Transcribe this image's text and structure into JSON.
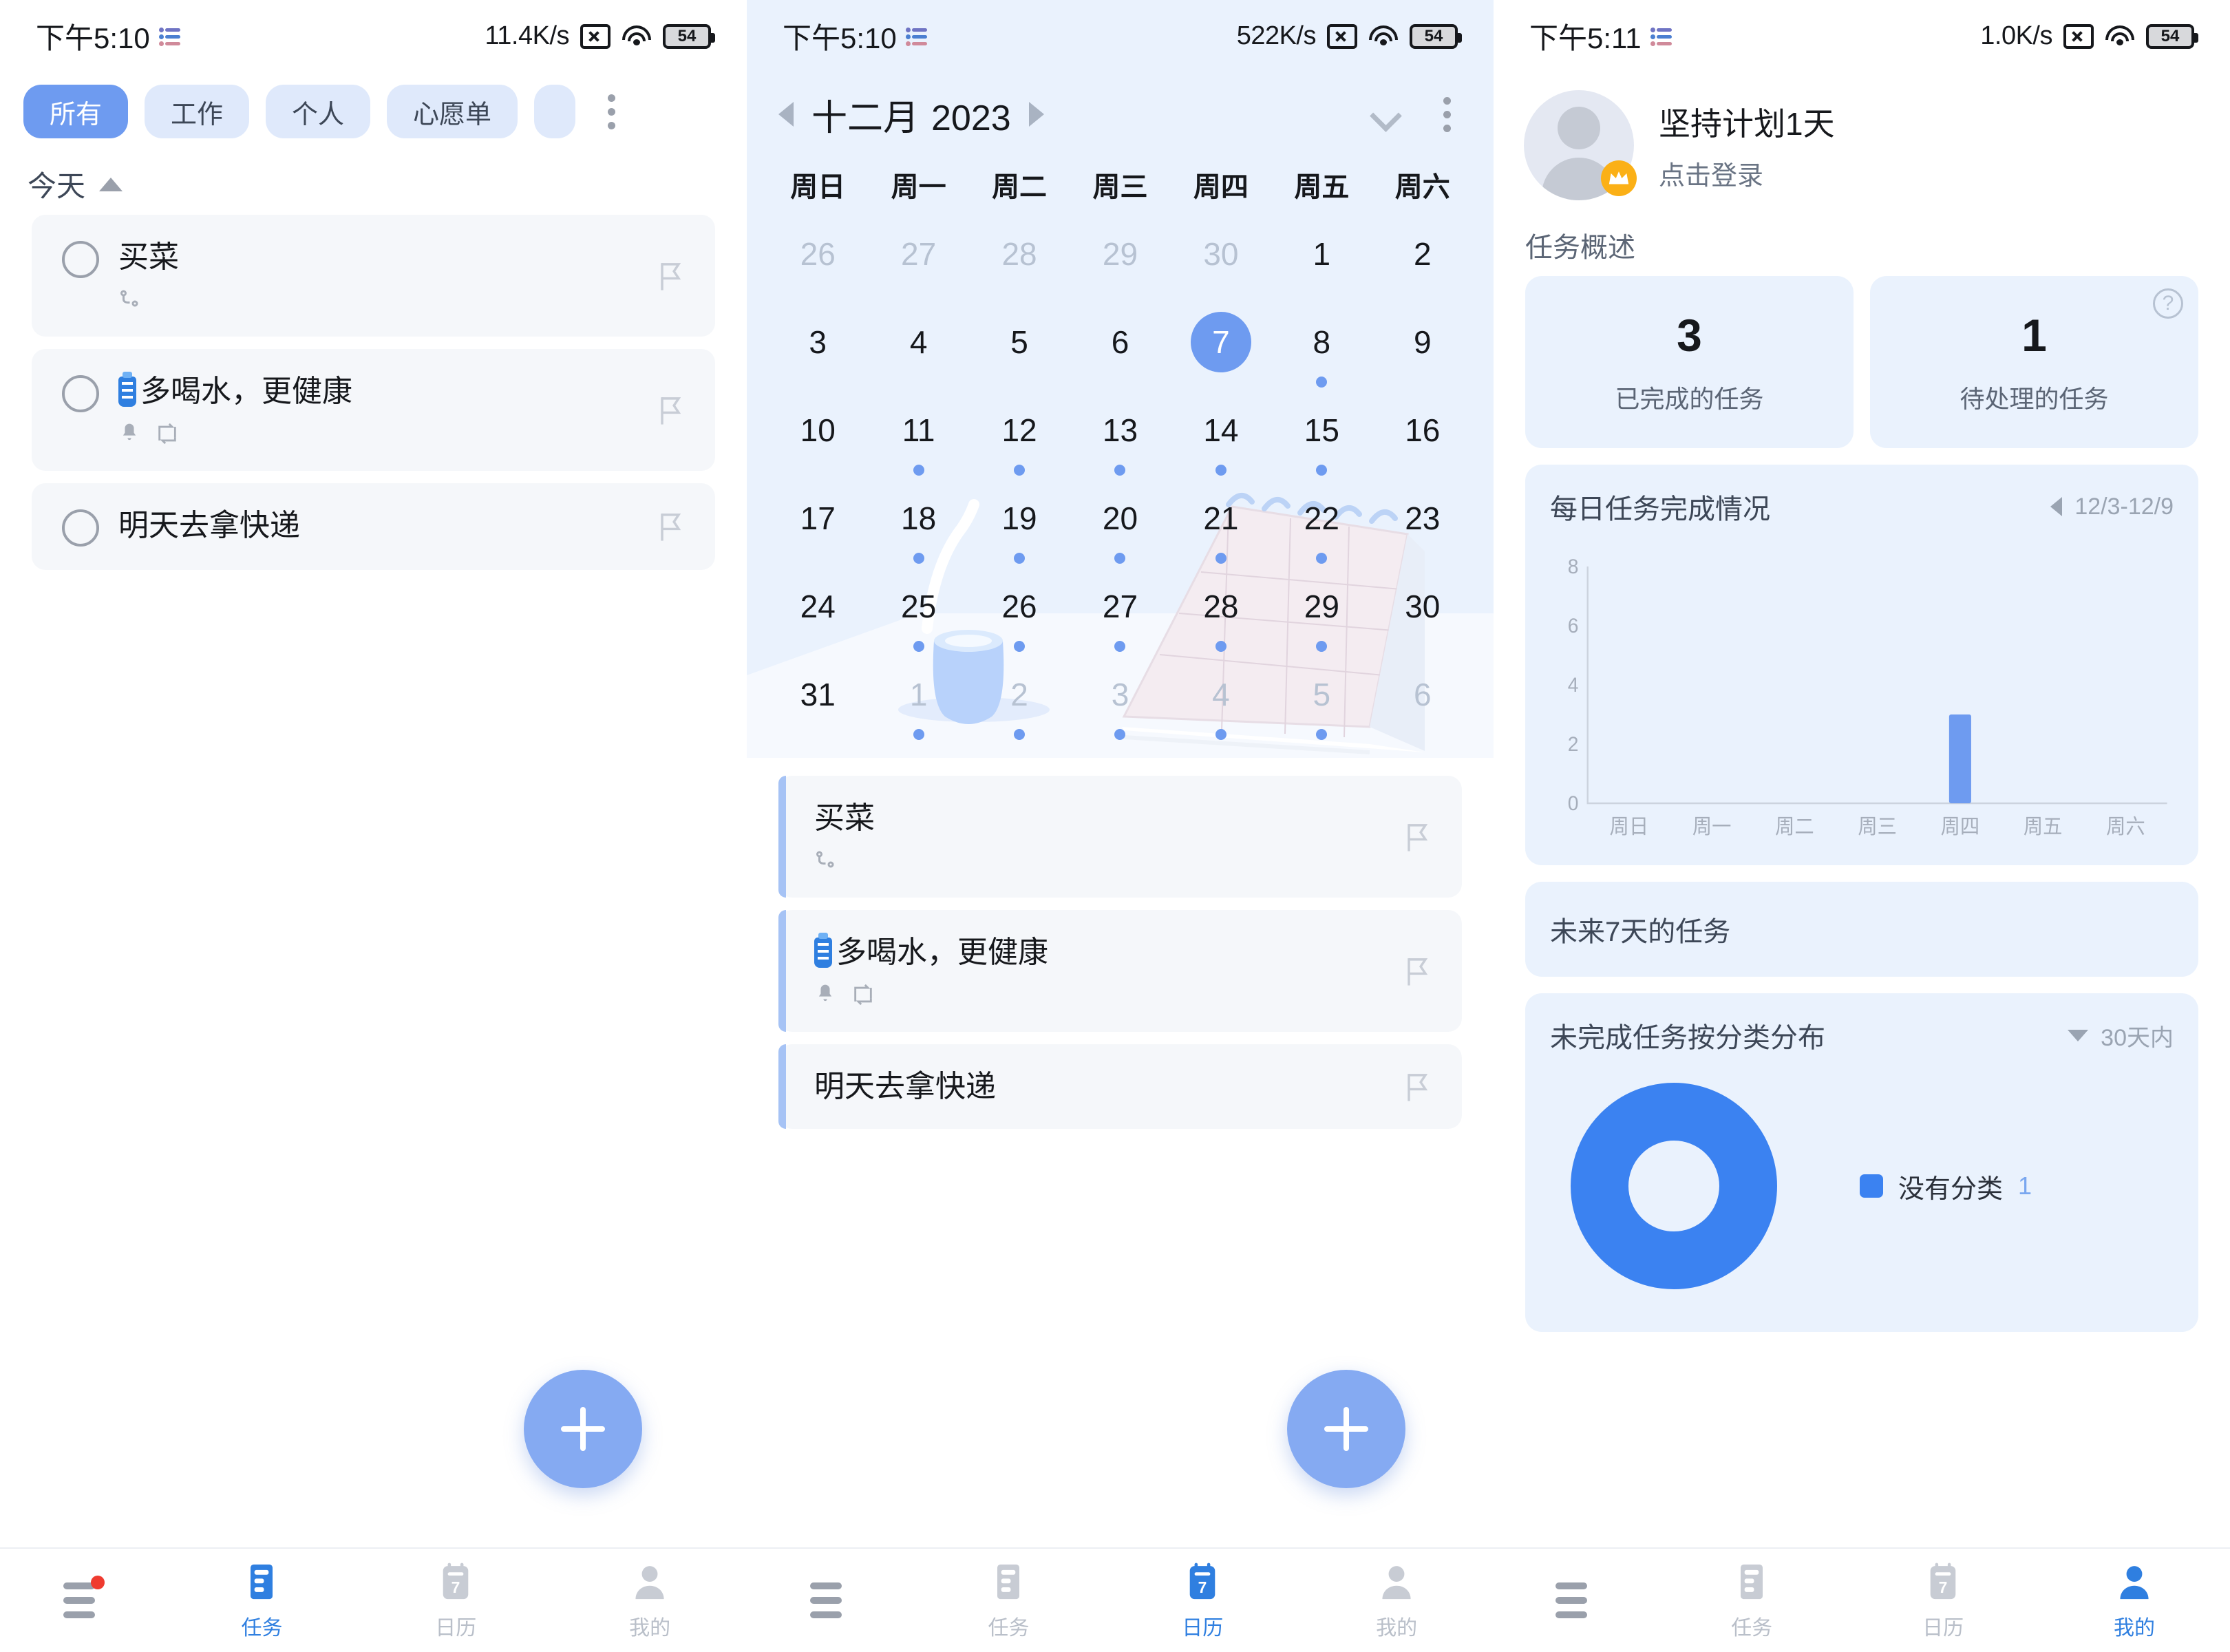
{
  "panels": [
    {
      "id": "tasks",
      "statusbar": {
        "time": "下午5:10",
        "speed": "11.4K/s",
        "battery": "54"
      },
      "chips": [
        {
          "label": "所有",
          "active": true
        },
        {
          "label": "工作",
          "active": false
        },
        {
          "label": "个人",
          "active": false
        },
        {
          "label": "心愿单",
          "active": false
        }
      ],
      "section_label": "今天",
      "tasks": [
        {
          "title": "买菜",
          "has_emoji": false,
          "meta": [
            "subtask-icon"
          ]
        },
        {
          "title": "多喝水，更健康",
          "has_emoji": true,
          "meta": [
            "bell-icon",
            "repeat-icon"
          ]
        },
        {
          "title": "明天去拿快递",
          "has_emoji": false,
          "meta": []
        }
      ],
      "nav": [
        {
          "label": "",
          "icon": "hamburger-icon",
          "active": false,
          "badge": true
        },
        {
          "label": "任务",
          "icon": "task-icon",
          "active": true
        },
        {
          "label": "日历",
          "icon": "calendar-icon",
          "active": false
        },
        {
          "label": "我的",
          "icon": "profile-icon",
          "active": false
        }
      ]
    },
    {
      "id": "calendar",
      "statusbar": {
        "time": "下午5:10",
        "speed": "522K/s",
        "battery": "54"
      },
      "header": {
        "month": "十二月",
        "year": "2023"
      },
      "weekdays": [
        "周日",
        "周一",
        "周二",
        "周三",
        "周四",
        "周五",
        "周六"
      ],
      "days": [
        {
          "n": "26",
          "muted": true,
          "dot": false
        },
        {
          "n": "27",
          "muted": true,
          "dot": false
        },
        {
          "n": "28",
          "muted": true,
          "dot": false
        },
        {
          "n": "29",
          "muted": true,
          "dot": false
        },
        {
          "n": "30",
          "muted": true,
          "dot": false
        },
        {
          "n": "1",
          "muted": false,
          "dot": false
        },
        {
          "n": "2",
          "muted": false,
          "dot": false
        },
        {
          "n": "3",
          "muted": false,
          "dot": false
        },
        {
          "n": "4",
          "muted": false,
          "dot": false
        },
        {
          "n": "5",
          "muted": false,
          "dot": false
        },
        {
          "n": "6",
          "muted": false,
          "dot": false
        },
        {
          "n": "7",
          "muted": false,
          "dot": false,
          "today": true
        },
        {
          "n": "8",
          "muted": false,
          "dot": true
        },
        {
          "n": "9",
          "muted": false,
          "dot": false
        },
        {
          "n": "10",
          "muted": false,
          "dot": false
        },
        {
          "n": "11",
          "muted": false,
          "dot": true
        },
        {
          "n": "12",
          "muted": false,
          "dot": true
        },
        {
          "n": "13",
          "muted": false,
          "dot": true
        },
        {
          "n": "14",
          "muted": false,
          "dot": true
        },
        {
          "n": "15",
          "muted": false,
          "dot": true
        },
        {
          "n": "16",
          "muted": false,
          "dot": false
        },
        {
          "n": "17",
          "muted": false,
          "dot": false
        },
        {
          "n": "18",
          "muted": false,
          "dot": true
        },
        {
          "n": "19",
          "muted": false,
          "dot": true
        },
        {
          "n": "20",
          "muted": false,
          "dot": true
        },
        {
          "n": "21",
          "muted": false,
          "dot": true
        },
        {
          "n": "22",
          "muted": false,
          "dot": true
        },
        {
          "n": "23",
          "muted": false,
          "dot": false
        },
        {
          "n": "24",
          "muted": false,
          "dot": false
        },
        {
          "n": "25",
          "muted": false,
          "dot": true
        },
        {
          "n": "26",
          "muted": false,
          "dot": true
        },
        {
          "n": "27",
          "muted": false,
          "dot": true
        },
        {
          "n": "28",
          "muted": false,
          "dot": true
        },
        {
          "n": "29",
          "muted": false,
          "dot": true
        },
        {
          "n": "30",
          "muted": false,
          "dot": false
        },
        {
          "n": "31",
          "muted": false,
          "dot": false
        },
        {
          "n": "1",
          "muted": true,
          "dot": true
        },
        {
          "n": "2",
          "muted": true,
          "dot": true
        },
        {
          "n": "3",
          "muted": true,
          "dot": true
        },
        {
          "n": "4",
          "muted": true,
          "dot": true
        },
        {
          "n": "5",
          "muted": true,
          "dot": true
        },
        {
          "n": "6",
          "muted": true,
          "dot": false
        }
      ],
      "tasks": [
        {
          "title": "买菜",
          "has_emoji": false,
          "meta": [
            "subtask-icon"
          ]
        },
        {
          "title": "多喝水，更健康",
          "has_emoji": true,
          "meta": [
            "bell-icon",
            "repeat-icon"
          ]
        },
        {
          "title": "明天去拿快递",
          "has_emoji": false,
          "meta": []
        }
      ],
      "nav": [
        {
          "label": "",
          "icon": "hamburger-icon",
          "active": false,
          "badge": false
        },
        {
          "label": "任务",
          "icon": "task-icon",
          "active": false
        },
        {
          "label": "日历",
          "icon": "calendar-icon",
          "active": true
        },
        {
          "label": "我的",
          "icon": "profile-icon",
          "active": false
        }
      ]
    },
    {
      "id": "profile",
      "statusbar": {
        "time": "下午5:11",
        "speed": "1.0K/s",
        "battery": "54"
      },
      "profile": {
        "name": "坚持计划1天",
        "sub": "点击登录"
      },
      "overview_title": "任务概述",
      "stats": [
        {
          "value": "3",
          "label": "已完成的任务",
          "help": false
        },
        {
          "value": "1",
          "label": "待处理的任务",
          "help": true,
          "help_glyph": "?"
        }
      ],
      "daily_card": {
        "title": "每日任务完成情况",
        "range": "12/3-12/9"
      },
      "upcoming_card": {
        "title": "未来7天的任务"
      },
      "category_card": {
        "title": "未完成任务按分类分布",
        "range": "30天内"
      },
      "legend": [
        {
          "name": "没有分类",
          "count": "1",
          "color": "#3b82f1"
        }
      ],
      "nav": [
        {
          "label": "",
          "icon": "hamburger-icon",
          "active": false,
          "badge": false
        },
        {
          "label": "任务",
          "icon": "task-icon",
          "active": false
        },
        {
          "label": "日历",
          "icon": "calendar-icon",
          "active": false
        },
        {
          "label": "我的",
          "icon": "profile-icon",
          "active": true
        }
      ]
    }
  ],
  "chart_data": [
    {
      "type": "bar",
      "title": "每日任务完成情况",
      "categories": [
        "周日",
        "周一",
        "周二",
        "周三",
        "周四",
        "周五",
        "周六"
      ],
      "values": [
        0,
        0,
        0,
        0,
        3,
        0,
        0
      ],
      "yticks": [
        0,
        2,
        4,
        6,
        8
      ],
      "ylim": [
        0,
        8
      ],
      "xlabel": "",
      "ylabel": "",
      "grid": false,
      "legend": "none",
      "bar_color": "#6e9bf0",
      "annotation": "12/3-12/9"
    },
    {
      "type": "pie",
      "title": "未完成任务按分类分布",
      "subtitle": "30天内",
      "labels": [
        "没有分类"
      ],
      "values": [
        1
      ],
      "colors": [
        "#3b82f1"
      ],
      "donut": true,
      "legend": "right"
    }
  ],
  "theme": {
    "accent": "#6e9bf0",
    "accent_strong": "#3b82f1",
    "chip_bg": "#dfe9fb",
    "card_bg": "#f5f7fa",
    "panel2_bg": "#eaf2fd",
    "text": "#16181c",
    "muted": "#9aa4b2",
    "badge": "#ef3b2f"
  }
}
